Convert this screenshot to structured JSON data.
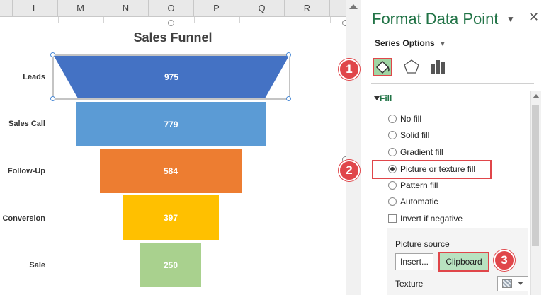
{
  "spreadsheet": {
    "column_headers": [
      "L",
      "M",
      "N",
      "O",
      "P",
      "Q",
      "R"
    ]
  },
  "chart_data": {
    "type": "funnel",
    "title": "Sales Funnel",
    "categories": [
      "Leads",
      "Sales Call",
      "Follow-Up",
      "Conversion",
      "Sale"
    ],
    "values": [
      975,
      779,
      584,
      397,
      250
    ],
    "colors": [
      "#4472c4",
      "#5b9bd5",
      "#ed7d31",
      "#ffc000",
      "#a9d18e"
    ],
    "selected_point": "Leads"
  },
  "pane": {
    "title": "Format Data Point",
    "series_options_label": "Series Options",
    "tabs": [
      {
        "name": "fill-line",
        "icon": "paint-bucket-icon",
        "active": true
      },
      {
        "name": "effects",
        "icon": "pentagon-icon",
        "active": false
      },
      {
        "name": "series-options",
        "icon": "bar-chart-icon",
        "active": false
      }
    ],
    "fill_section_label": "Fill",
    "fill_options": [
      {
        "label": "No fill",
        "selected": false
      },
      {
        "label": "Solid fill",
        "selected": false
      },
      {
        "label": "Gradient fill",
        "selected": false
      },
      {
        "label": "Picture or texture fill",
        "selected": true
      },
      {
        "label": "Pattern fill",
        "selected": false
      },
      {
        "label": "Automatic",
        "selected": false
      }
    ],
    "invert_label": "Invert if negative",
    "picture_source_label": "Picture source",
    "insert_button": "Insert...",
    "clipboard_button": "Clipboard",
    "texture_label": "Texture"
  },
  "markers": [
    "1",
    "2",
    "3"
  ],
  "accent_color": "#e0464a",
  "excel_green": "#217346"
}
